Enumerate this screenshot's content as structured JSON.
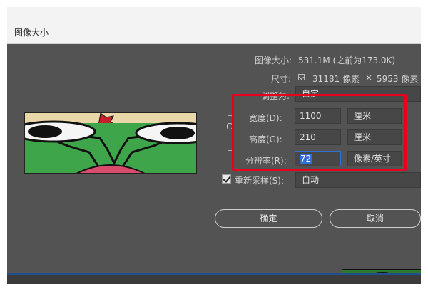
{
  "window": {
    "title": "图像大小"
  },
  "info": {
    "image_size_label": "图像大小:",
    "image_size_value": "531.1M (之前为173.0K)",
    "dimensions_label": "尺寸:",
    "width_px": "31181 像素",
    "times": "×",
    "height_px": "5953 像素"
  },
  "fit_to": {
    "label": "调整为:",
    "value": "自定"
  },
  "width": {
    "label": "宽度(D):",
    "value": "1100",
    "unit": "厘米"
  },
  "height": {
    "label": "高度(G):",
    "value": "210",
    "unit": "厘米"
  },
  "resolution": {
    "label": "分辨率(R):",
    "value": "72",
    "unit": "像素/英寸"
  },
  "resample": {
    "label": "重新采样(S):",
    "value": "自动",
    "checked": true
  },
  "buttons": {
    "ok": "确定",
    "cancel": "取消"
  },
  "colors": {
    "dialog_bg": "#535353",
    "field_bg": "#474747",
    "highlight": "#e8001c",
    "selection": "#2f6fd6"
  }
}
